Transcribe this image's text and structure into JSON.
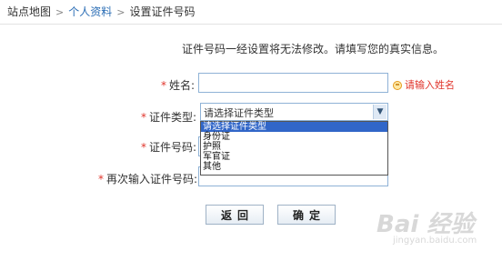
{
  "breadcrumb": {
    "items": [
      "站点地图",
      "个人资料"
    ],
    "separator": ">",
    "current": "设置证件号码"
  },
  "notice": "证件号码一经设置将无法修改。请填写您的真实信息。",
  "form": {
    "required_mark": "*",
    "name_label": "姓名:",
    "name_value": "",
    "name_hint": "请输入姓名",
    "id_type_label": "证件类型:",
    "id_type_selected": "请选择证件类型",
    "id_type_options": [
      "请选择证件类型",
      "身份证",
      "护照",
      "军官证",
      "其他"
    ],
    "id_number_label": "证件号码:",
    "id_number_value": "",
    "id_number_confirm_label": "再次输入证件号码:",
    "id_number_confirm_value": ""
  },
  "buttons": {
    "back_label": "返回",
    "confirm_label": "确定"
  },
  "watermark": {
    "logo": "Bai 经验",
    "url": "jingyan.baidu.com"
  },
  "colors": {
    "required": "#e0342b",
    "link": "#2a6db5",
    "selected_option": "#3166c8",
    "field_border": "#8fb2d6"
  },
  "icons": {
    "hint": "smiley-face-icon",
    "select": "chevron-down-icon"
  }
}
